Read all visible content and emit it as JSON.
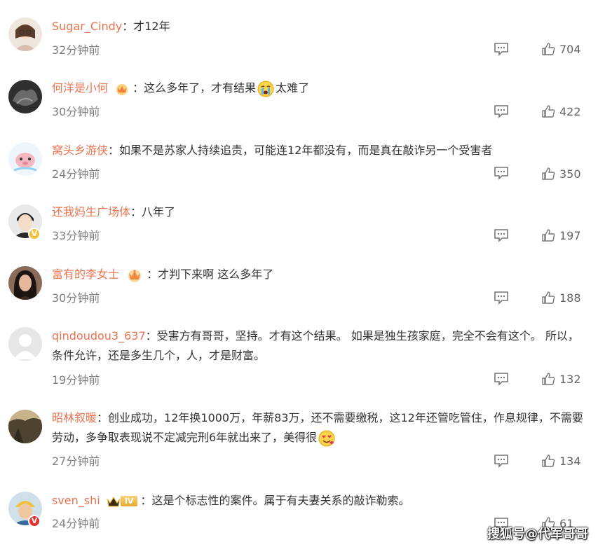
{
  "comments": [
    {
      "user": "Sugar_Cindy",
      "sep": "：",
      "text": "才12年",
      "time": "32分钟前",
      "likes": "704",
      "avatar_color": "#e8d8cc"
    },
    {
      "user": "何洋是小何",
      "sep": "：",
      "text": "这么多年了，才有结果",
      "text2": "太难了",
      "time": "30分钟前",
      "likes": "422",
      "avatar_color": "#3a3a3a"
    },
    {
      "user": "窝头乡游侠",
      "sep": "：",
      "text": "如果不是苏家人持续追责，可能连12年都没有，而是真在敲诈另一个受害者",
      "time": "24分钟前",
      "likes": "350",
      "avatar_color": "#f3c7c7"
    },
    {
      "user": "还我妈生广场体",
      "sep": "：",
      "text": "八年了",
      "time": "33分钟前",
      "likes": "197",
      "avatar_color": "#2c2a28"
    },
    {
      "user": "富有的李女士",
      "sep": "：",
      "text": "才判下来啊 这么多年了",
      "time": "30分钟前",
      "likes": "188",
      "avatar_color": "#5a3a30"
    },
    {
      "user": "qindoudou3_637",
      "sep": "：",
      "text": "受害方有哥哥，坚持。才有这个结果。 如果是独生孩家庭，完全不会有这个。 所以，条件允许，还是多生几个，人，才是财富。",
      "time": "19分钟前",
      "likes": "132",
      "avatar_color": "#e6e6e6"
    },
    {
      "user": "昭林叙暖",
      "sep": "：",
      "text": "创业成功，12年换1000万，年薪83万，还不需要缴税，这12年还管吃管住，作息规律，不需要劳动，多争取表现说不定减完刑6年就出来了，美得很",
      "time": "27分钟前",
      "likes": "134",
      "avatar_color": "#6b5a3e"
    },
    {
      "user": "sven_shi",
      "sep": "：",
      "text": "这是个标志性的案件。属于有夫妻关系的敲诈勒索。",
      "time": "24分钟前",
      "likes": "61",
      "avatar_color": "#d8b070"
    }
  ],
  "vip_level": "IV",
  "verified_badge": "V",
  "watermark": "搜狐号@代军哥哥",
  "colors": {
    "username": "#eb7350",
    "time": "#808080",
    "text": "#333333"
  }
}
